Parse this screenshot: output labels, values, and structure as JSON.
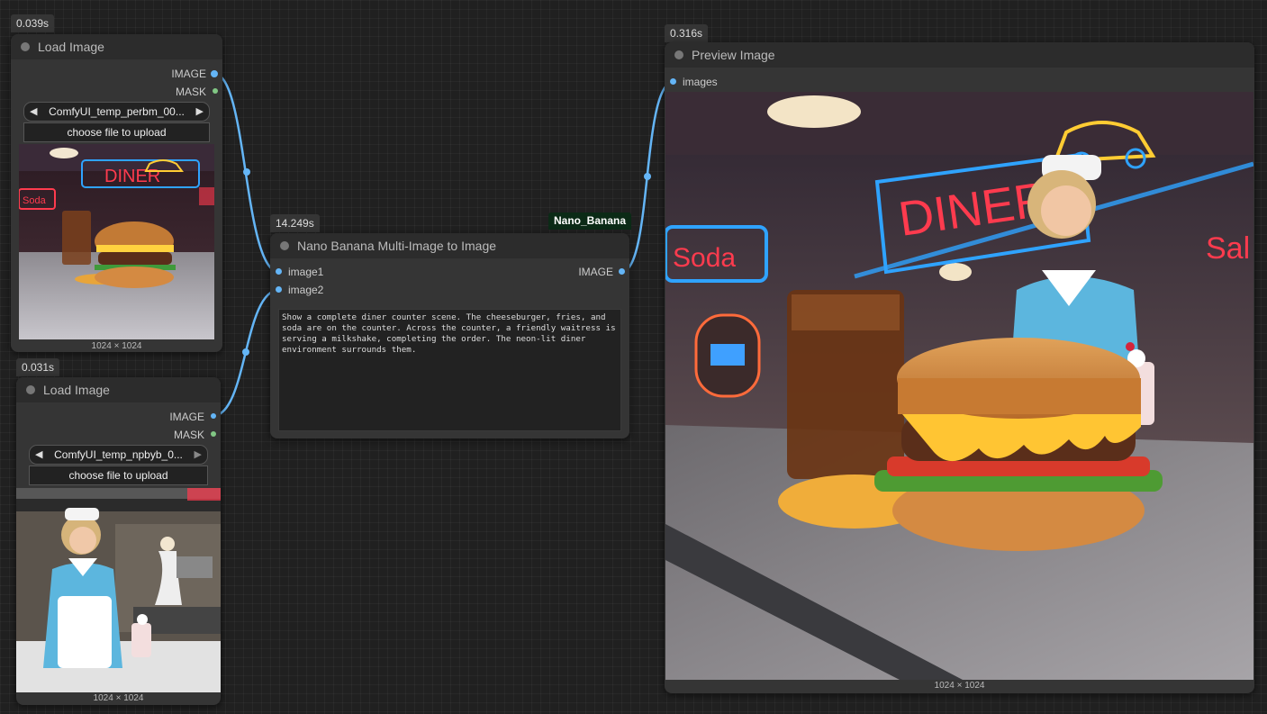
{
  "nodes": {
    "load1": {
      "timing": "0.039s",
      "title": "Load Image",
      "outputs": [
        "IMAGE",
        "MASK"
      ],
      "image_value": "ComfyUI_temp_perbm_00...",
      "upload_label": "choose file to upload",
      "dimensions": "1024 × 1024"
    },
    "load2": {
      "timing": "0.031s",
      "title": "Load Image",
      "outputs": [
        "IMAGE",
        "MASK"
      ],
      "image_value": "ComfyUI_temp_npbyb_0...",
      "upload_label": "choose file to upload",
      "dimensions": "1024 × 1024"
    },
    "nano": {
      "timing": "14.249s",
      "badge": "Nano_Banana",
      "title": "Nano Banana Multi-Image to Image",
      "inputs": [
        "image1",
        "image2"
      ],
      "output": "IMAGE",
      "prompt": "Show a complete diner counter scene. The cheeseburger, fries, and soda are on the counter. Across the counter, a friendly waitress is serving a milkshake, completing the order. The neon-lit diner environment surrounds them."
    },
    "preview": {
      "timing": "0.316s",
      "title": "Preview Image",
      "input": "images",
      "dimensions": "1024 × 1024"
    }
  },
  "image_text": {
    "diner": "DINER",
    "soda": "Soda"
  },
  "colors": {
    "image_slot": "#64b5f6",
    "mask_slot": "#81c784",
    "wire": "#64b5f6",
    "neon_red": "#ff3b4e",
    "neon_blue": "#2fa3ff"
  }
}
